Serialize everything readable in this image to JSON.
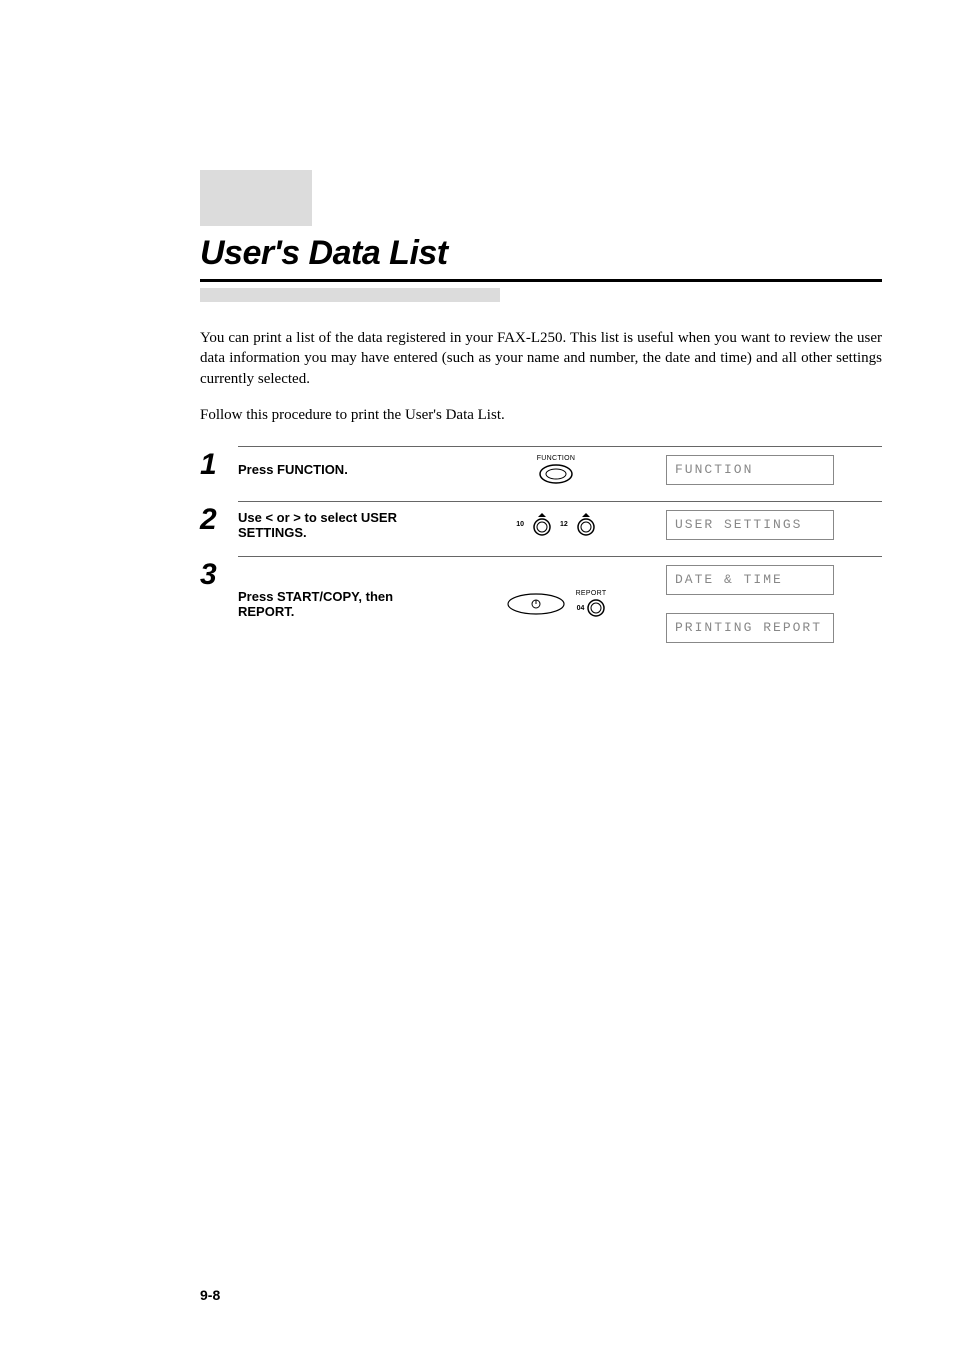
{
  "title": "User's Data List",
  "intro": "You can print a list of the data registered in your FAX-L250. This list is useful when you want to review the user data information you may have entered (such as your name and number, the date and time) and all other settings currently selected.",
  "follow": "Follow this procedure to print the User's Data List.",
  "steps": {
    "s1": {
      "num": "1",
      "text": "Press FUNCTION.",
      "label_function": "FUNCTION",
      "lcd": "FUNCTION"
    },
    "s2": {
      "num": "2",
      "text_pre": "Use ",
      "lt": "<",
      "text_mid": " or ",
      "gt": ">",
      "text_post": " to select USER SETTINGS.",
      "k10": "10",
      "k12": "12",
      "lcd": "USER SETTINGS"
    },
    "s3": {
      "num": "3",
      "text": "Press START/COPY, then REPORT.",
      "label_report": "REPORT",
      "k04": "04",
      "lcd1": "DATE & TIME",
      "lcd2": "PRINTING REPORT"
    }
  },
  "page_number": "9-8"
}
